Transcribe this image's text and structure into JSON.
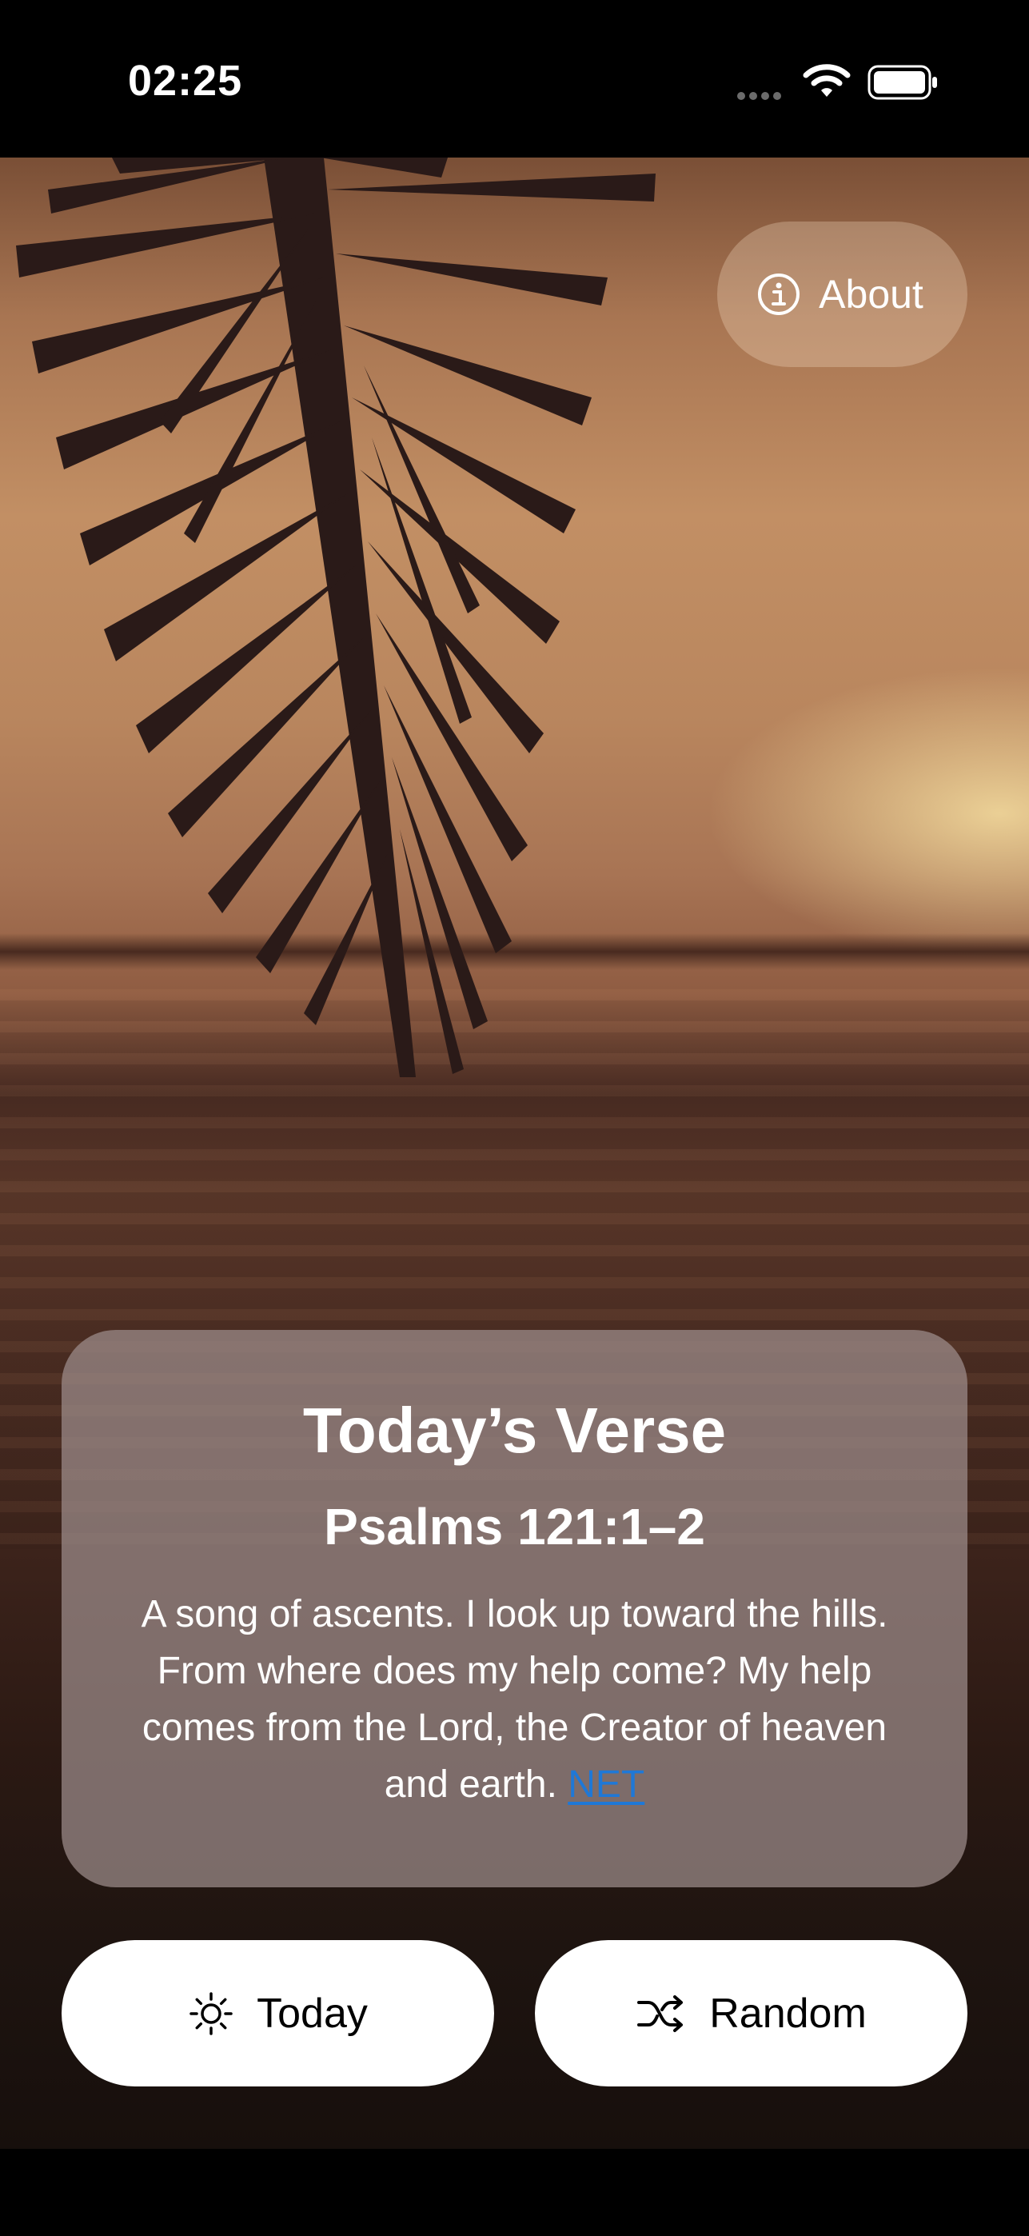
{
  "status_bar": {
    "time": "02:25",
    "icons": [
      "cellular-signal-icon",
      "wifi-icon",
      "battery-icon"
    ]
  },
  "about_button": {
    "label": "About",
    "icon": "info-circle-icon"
  },
  "verse_card": {
    "title": "Today’s Verse",
    "reference": "Psalms 121:1–2",
    "text": "A song of ascents. I look up toward the hills. From where does my help come? My help comes from the Lord, the Creator of heaven and earth.",
    "source": "NET"
  },
  "actions": {
    "today": {
      "label": "Today",
      "icon": "sun-icon"
    },
    "random": {
      "label": "Random",
      "icon": "shuffle-icon"
    }
  },
  "colors": {
    "link": "#1f78d6",
    "card_background": "#9e8e8c",
    "button_background": "#ffffff"
  }
}
